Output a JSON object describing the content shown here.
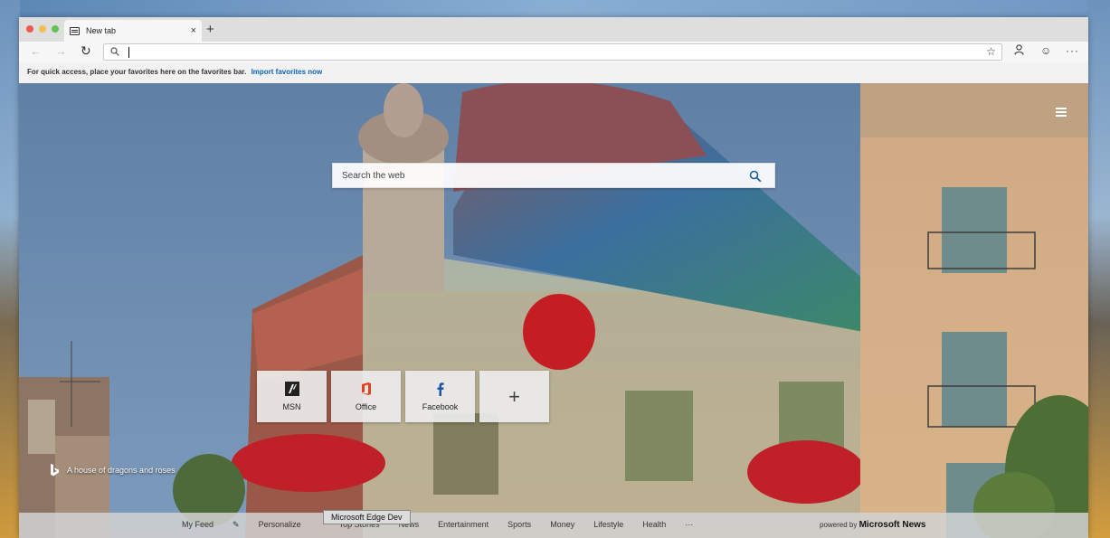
{
  "browser": {
    "tab": {
      "title": "New tab",
      "close": "×"
    },
    "new_tab_button": "+",
    "address_bar": {
      "value": ""
    },
    "favorites_bar": {
      "message": "For quick access, place your favorites here on the favorites bar.",
      "link": "Import favorites now"
    }
  },
  "new_tab_page": {
    "search": {
      "placeholder": "Search the web"
    },
    "quick_links": [
      {
        "label": "MSN"
      },
      {
        "label": "Office"
      },
      {
        "label": "Facebook"
      },
      {
        "label": ""
      }
    ],
    "add_tile": "+",
    "image_caption": "A house of dragons and roses",
    "tooltip": "Microsoft Edge Dev",
    "news_nav": [
      "My Feed",
      "Personalize",
      "Top Stories",
      "News",
      "Entertainment",
      "Sports",
      "Money",
      "Lifestyle",
      "Health",
      "···"
    ],
    "powered_by": {
      "prefix": "powered by",
      "brand": "Microsoft News"
    }
  },
  "colors": {
    "link": "#0b63b6",
    "office": "#e3421c",
    "facebook": "#1d56a8"
  }
}
